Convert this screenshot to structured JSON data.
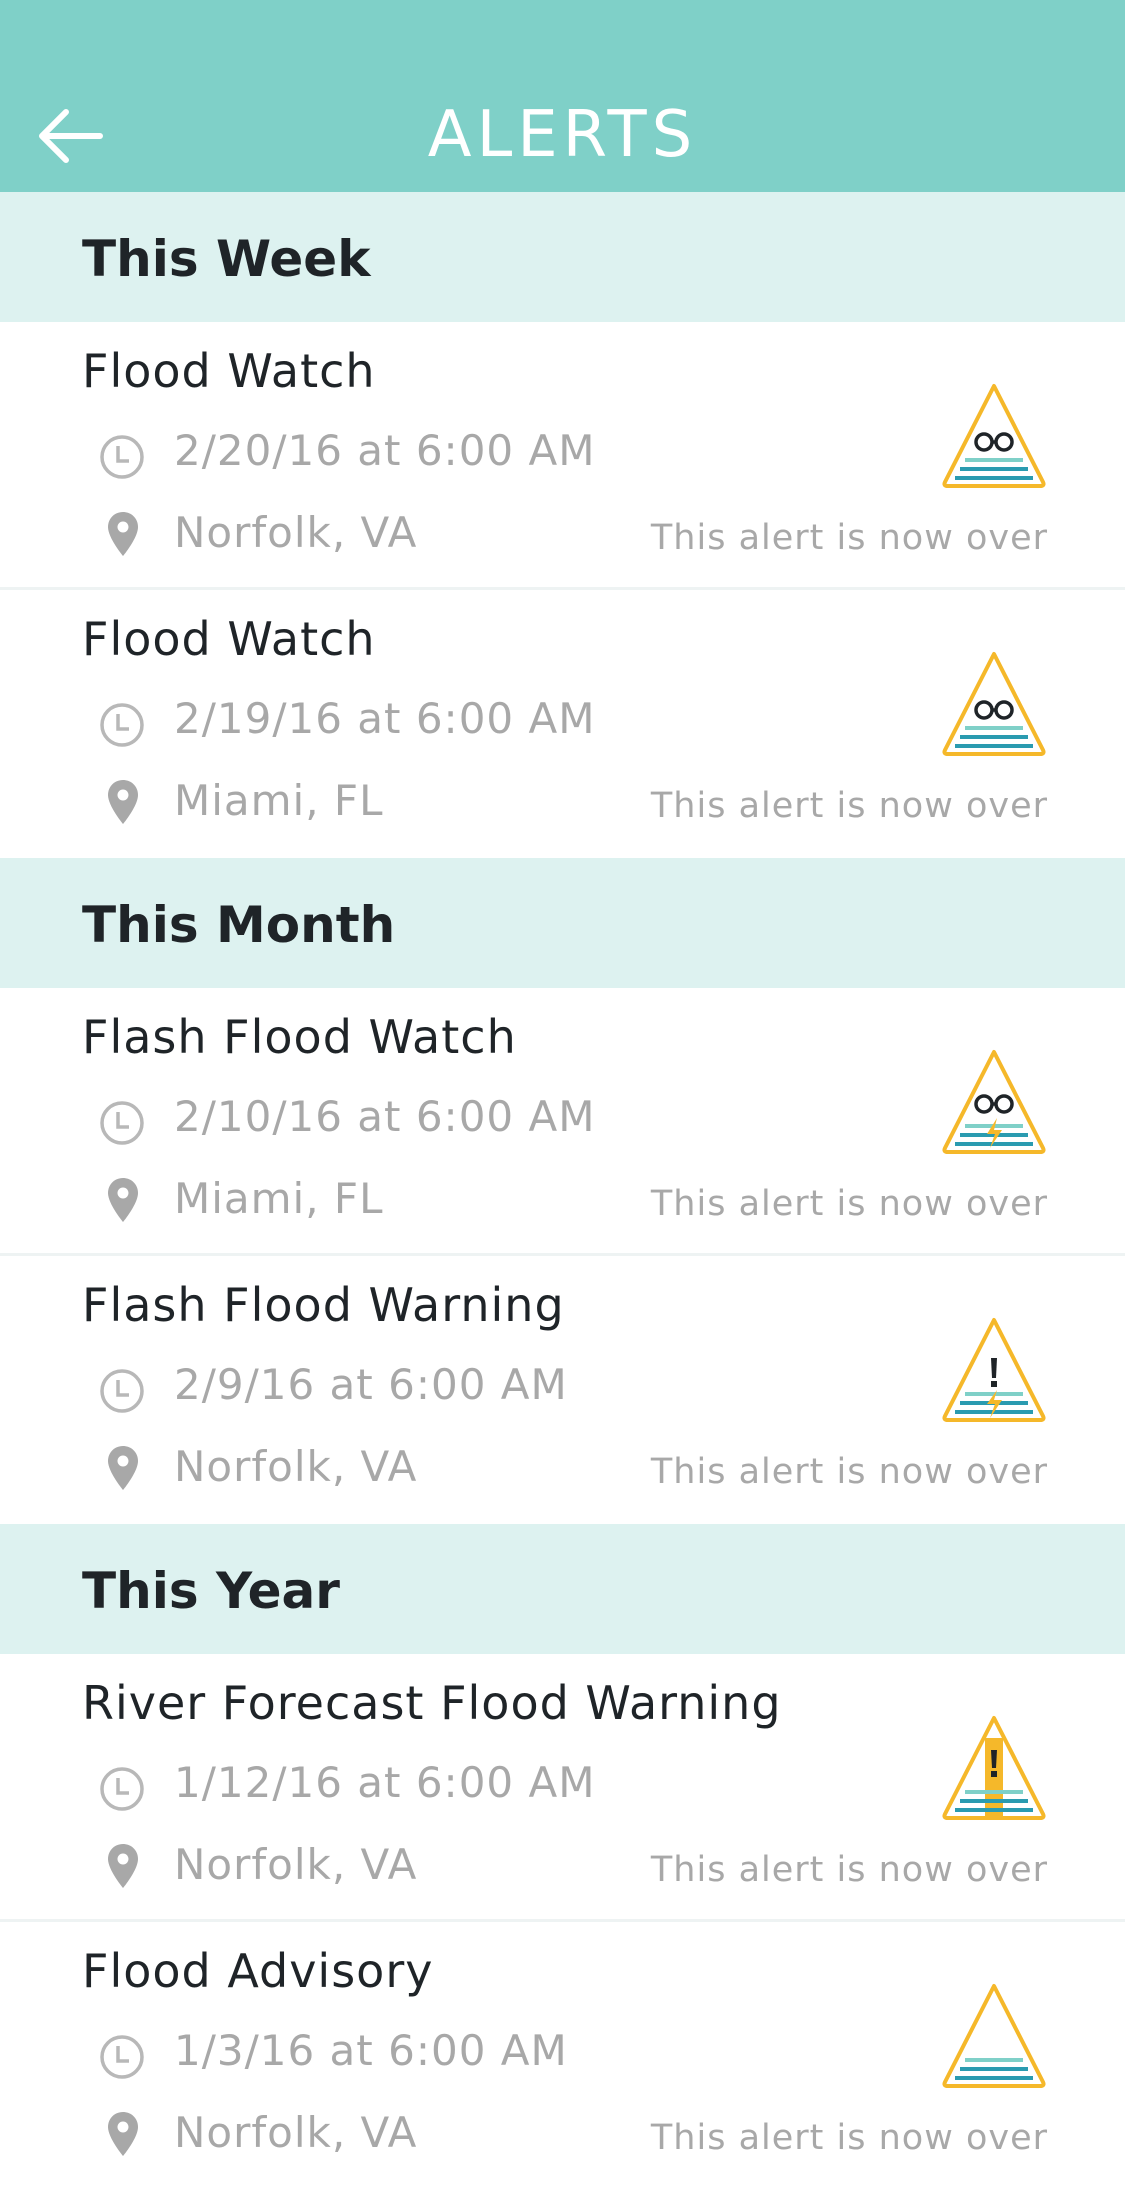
{
  "header": {
    "title": "ALERTS",
    "back_icon": "arrow-left-icon",
    "background_color": "#7fd0c8"
  },
  "sections": [
    {
      "title": "This Week",
      "alerts": [
        {
          "title": "Flood Watch",
          "time": "2/20/16 at 6:00 AM",
          "location": "Norfolk, VA",
          "status": "This alert is now over",
          "badge": "flood-watch-icon"
        },
        {
          "title": "Flood Watch",
          "time": "2/19/16 at 6:00 AM",
          "location": "Miami, FL",
          "status": "This alert is now over",
          "badge": "flood-watch-icon"
        }
      ]
    },
    {
      "title": "This Month",
      "alerts": [
        {
          "title": "Flash Flood Watch",
          "time": "2/10/16 at 6:00 AM",
          "location": "Miami, FL",
          "status": "This alert is now over",
          "badge": "flash-flood-watch-icon"
        },
        {
          "title": "Flash Flood Warning",
          "time": "2/9/16 at 6:00 AM",
          "location": "Norfolk, VA",
          "status": "This alert is now over",
          "badge": "flash-flood-warning-icon"
        }
      ]
    },
    {
      "title": "This Year",
      "alerts": [
        {
          "title": "River Forecast Flood Warning",
          "time": "1/12/16 at 6:00 AM",
          "location": "Norfolk, VA",
          "status": "This alert is now over",
          "badge": "river-flood-warning-icon"
        },
        {
          "title": "Flood Advisory",
          "time": "1/3/16 at 6:00 AM",
          "location": "Norfolk, VA",
          "status": "This alert is now over",
          "badge": "flood-advisory-icon"
        }
      ]
    }
  ],
  "colors": {
    "section_background": "#ddf2f0",
    "triangle_outline": "#f5b82a",
    "water_dark": "#2a9bb0",
    "water_light": "#7fd0c8"
  }
}
